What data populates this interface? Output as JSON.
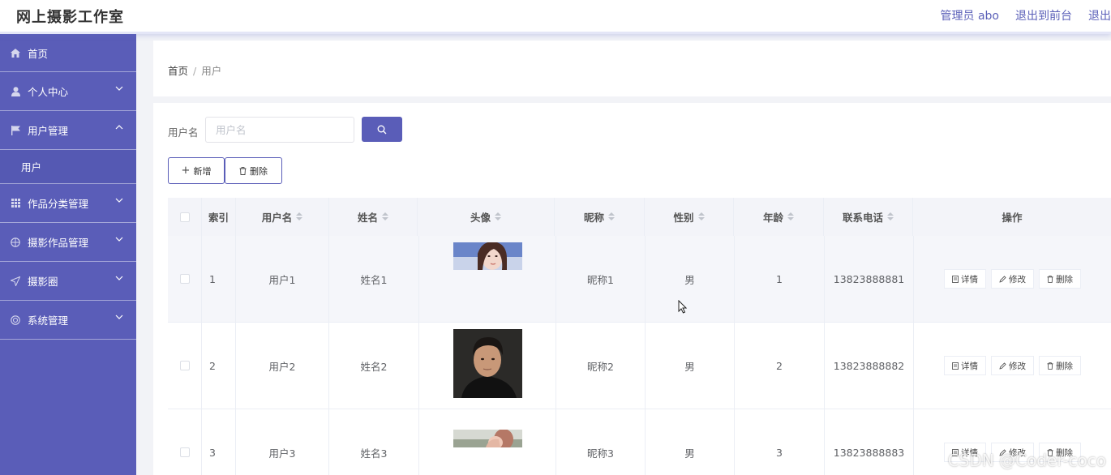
{
  "header": {
    "title": "网上摄影工作室",
    "links": [
      "管理员 abo",
      "退出到前台",
      "退出"
    ]
  },
  "sidebar": {
    "items": [
      {
        "label": "首页",
        "icon": "home-icon"
      },
      {
        "label": "个人中心",
        "icon": "user-icon"
      },
      {
        "label": "用户管理",
        "icon": "flag-icon",
        "expanded": true,
        "children": [
          "用户"
        ]
      },
      {
        "label": "作品分类管理",
        "icon": "grid-icon"
      },
      {
        "label": "摄影作品管理",
        "icon": "compass-icon"
      },
      {
        "label": "摄影圈",
        "icon": "send-icon"
      },
      {
        "label": "系统管理",
        "icon": "lifebuoy-icon"
      }
    ]
  },
  "breadcrumb": {
    "home": "首页",
    "separator": "/",
    "current": "用户"
  },
  "search": {
    "label": "用户名",
    "placeholder": "用户名",
    "value": ""
  },
  "actions": {
    "add": "新增",
    "delete": "删除"
  },
  "table": {
    "columns": [
      "索引",
      "用户名",
      "姓名",
      "头像",
      "昵称",
      "性别",
      "年龄",
      "联系电话",
      "操作"
    ],
    "rows": [
      {
        "index": "1",
        "username": "用户1",
        "name": "姓名1",
        "nickname": "昵称1",
        "gender": "男",
        "age": "1",
        "phone": "13823888881"
      },
      {
        "index": "2",
        "username": "用户2",
        "name": "姓名2",
        "nickname": "昵称2",
        "gender": "男",
        "age": "2",
        "phone": "13823888882"
      },
      {
        "index": "3",
        "username": "用户3",
        "name": "姓名3",
        "nickname": "昵称3",
        "gender": "男",
        "age": "3",
        "phone": "13823888883"
      }
    ],
    "row_actions": [
      "详情",
      "修改",
      "删除"
    ]
  },
  "watermark": "CSDN @Coder-coco",
  "colors": {
    "accent": "#5a5db8"
  }
}
